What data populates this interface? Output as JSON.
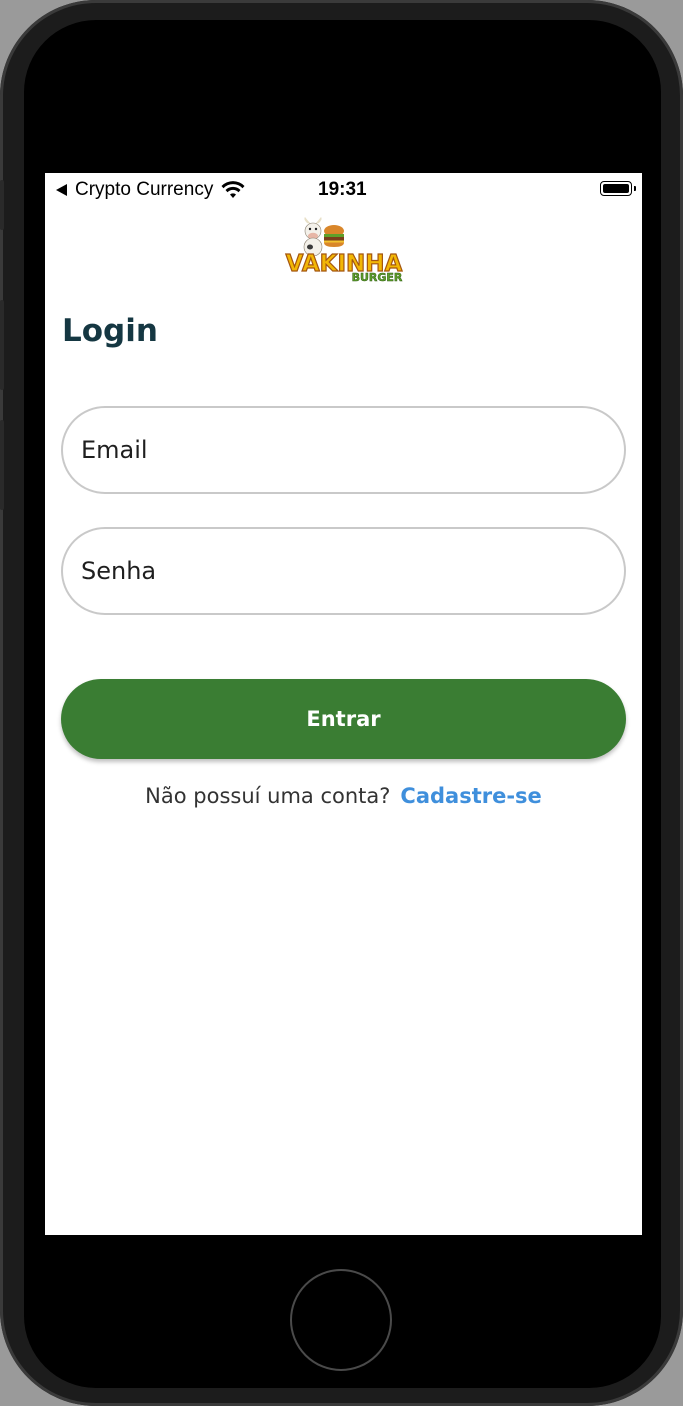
{
  "status_bar": {
    "back_label": "Crypto Currency",
    "time": "19:31",
    "icons": [
      "back-arrow-icon",
      "wifi-icon",
      "battery-icon"
    ]
  },
  "logo": {
    "name": "vakinha-burger-logo",
    "text_main": "VAKINHA",
    "text_sub": "BURGER"
  },
  "page": {
    "title": "Login"
  },
  "form": {
    "email_placeholder": "Email",
    "password_placeholder": "Senha",
    "submit_label": "Entrar"
  },
  "signup": {
    "prompt": "Não possuí uma conta?",
    "link_label": "Cadastre-se"
  },
  "colors": {
    "primary_green": "#3a7d33",
    "title_color": "#153742",
    "link_blue": "#3f8fdc",
    "logo_yellow": "#f2b705",
    "logo_green": "#5ea02a"
  }
}
